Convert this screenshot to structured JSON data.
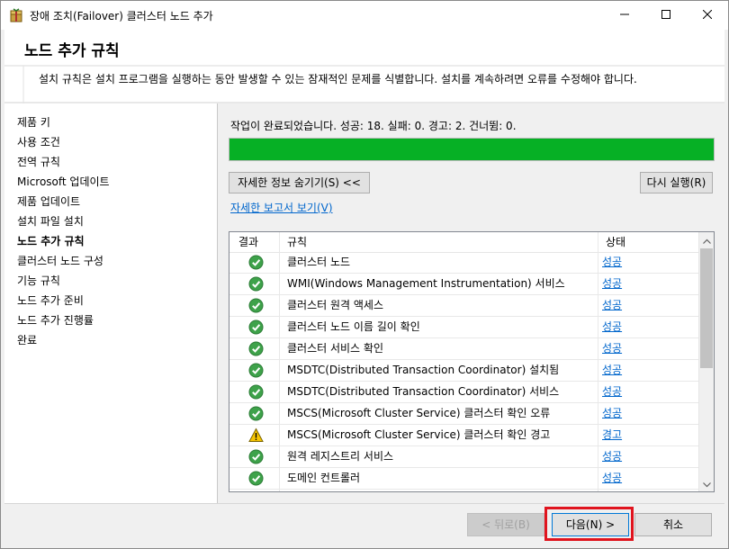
{
  "window": {
    "title": "장애 조치(Failover) 클러스터 노드 추가",
    "minimize_icon": "minimize-icon",
    "maximize_icon": "maximize-icon",
    "close_icon": "close-icon"
  },
  "header": {
    "title": "노드 추가 규칙",
    "description": "설치 규칙은 설치 프로그램을 실행하는 동안 발생할 수 있는 잠재적인 문제를 식별합니다. 설치를 계속하려면 오류를 수정해야 합니다."
  },
  "nav": {
    "items": [
      {
        "label": "제품 키"
      },
      {
        "label": "사용 조건"
      },
      {
        "label": "전역 규칙"
      },
      {
        "label": "Microsoft 업데이트"
      },
      {
        "label": "제품 업데이트"
      },
      {
        "label": "설치 파일 설치"
      },
      {
        "label": "노드 추가 규칙"
      },
      {
        "label": "클러스터 노드 구성"
      },
      {
        "label": "기능 규칙"
      },
      {
        "label": "노드 추가 준비"
      },
      {
        "label": "노드 추가 진행률"
      },
      {
        "label": "완료"
      }
    ],
    "active_index": 6
  },
  "content": {
    "status_text": "작업이 완료되었습니다. 성공: 18. 실패: 0. 경고: 2. 건너뜀: 0.",
    "progress_percent": 100,
    "progress_color": "#06b025",
    "hide_details_button": "자세한 정보 숨기기(S) <<",
    "rerun_button": "다시 실행(R)",
    "report_link": "자세한 보고서 보기(V)"
  },
  "grid": {
    "columns": [
      "결과",
      "규칙",
      "상태"
    ],
    "rows": [
      {
        "icon": "success-check-icon",
        "rule": "클러스터 노드",
        "status": "성공"
      },
      {
        "icon": "success-check-icon",
        "rule": "WMI(Windows Management Instrumentation) 서비스",
        "status": "성공"
      },
      {
        "icon": "success-check-icon",
        "rule": "클러스터 원격 액세스",
        "status": "성공"
      },
      {
        "icon": "success-check-icon",
        "rule": "클러스터 노드 이름 길이 확인",
        "status": "성공"
      },
      {
        "icon": "success-check-icon",
        "rule": "클러스터 서비스 확인",
        "status": "성공"
      },
      {
        "icon": "success-check-icon",
        "rule": "MSDTC(Distributed Transaction Coordinator) 설치됨",
        "status": "성공"
      },
      {
        "icon": "success-check-icon",
        "rule": "MSDTC(Distributed Transaction Coordinator) 서비스",
        "status": "성공"
      },
      {
        "icon": "success-check-icon",
        "rule": "MSCS(Microsoft Cluster Service) 클러스터 확인 오류",
        "status": "성공"
      },
      {
        "icon": "warning-triangle-icon",
        "rule": "MSCS(Microsoft Cluster Service) 클러스터 확인 경고",
        "status": "경고"
      },
      {
        "icon": "success-check-icon",
        "rule": "원격 레지스트리 서비스",
        "status": "성공"
      },
      {
        "icon": "success-check-icon",
        "rule": "도메인 컨트롤러",
        "status": "성공"
      }
    ]
  },
  "footer": {
    "back_button": "< 뒤로(B)",
    "next_button": "다음(N) >",
    "cancel_button": "취소"
  },
  "colors": {
    "success": "#3ea24a",
    "warning": "#f5c400",
    "highlight": "#e0141e",
    "link": "#0066cc"
  }
}
